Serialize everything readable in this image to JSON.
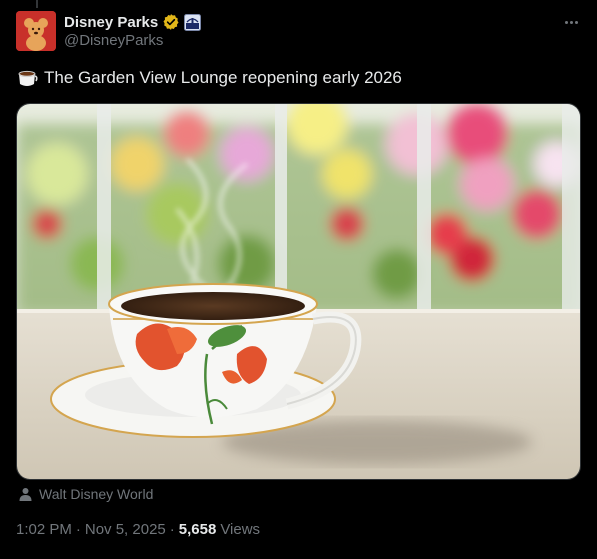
{
  "author": {
    "display_name": "Disney Parks",
    "handle": "@DisneyParks",
    "verified_icon": "verified-gold-badge-icon",
    "affiliate_icon": "disney-affiliate-badge-icon"
  },
  "post": {
    "emoji": "☕",
    "text": "The Garden View Lounge reopening early 2026",
    "media_alt": "teacup-on-table-garden-background-photo"
  },
  "location": {
    "icon": "person-icon",
    "label": "Walt Disney World"
  },
  "meta": {
    "time": "1:02 PM",
    "separator": "·",
    "date": "Nov 5, 2025",
    "views_count": "5,658",
    "views_label": "Views"
  },
  "colors": {
    "background": "#000000",
    "text_primary": "#e7e9ea",
    "text_secondary": "#71767b",
    "verified_gold": "#e2b719"
  }
}
